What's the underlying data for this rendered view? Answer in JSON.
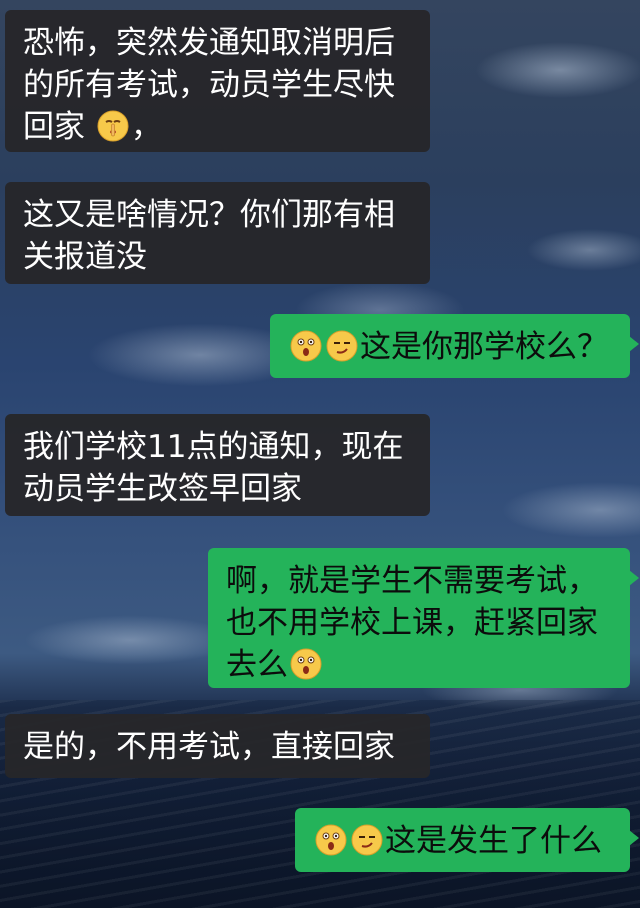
{
  "chat": {
    "messages": [
      {
        "side": "left",
        "text": "恐怖，突然发通知取消明后的所有考试，动员学生尽快回家",
        "emoji_after": "shushing-face",
        "trailing_text": "，"
      },
      {
        "side": "left",
        "text": "这又是啥情况？你们那有相关报道没"
      },
      {
        "side": "right",
        "emoji_before": [
          "astonished-face",
          "smirking-face"
        ],
        "text": "这是你那学校么？"
      },
      {
        "side": "left",
        "text": "我们学校11点的通知，现在动员学生改签早回家"
      },
      {
        "side": "right",
        "text": "啊，就是学生不需要考试，也不用学校上课，赶紧回家去么",
        "emoji_after": "astonished-face"
      },
      {
        "side": "left",
        "text": "是的，不用考试，直接回家"
      },
      {
        "side": "right",
        "emoji_before": [
          "astonished-face",
          "smirking-face"
        ],
        "text": "这是发生了什么"
      }
    ]
  },
  "colors": {
    "incoming_bubble": "#26262a",
    "outgoing_bubble": "#24b35a",
    "wallpaper_sky": "#2a4470",
    "wallpaper_sea": "#152440"
  }
}
